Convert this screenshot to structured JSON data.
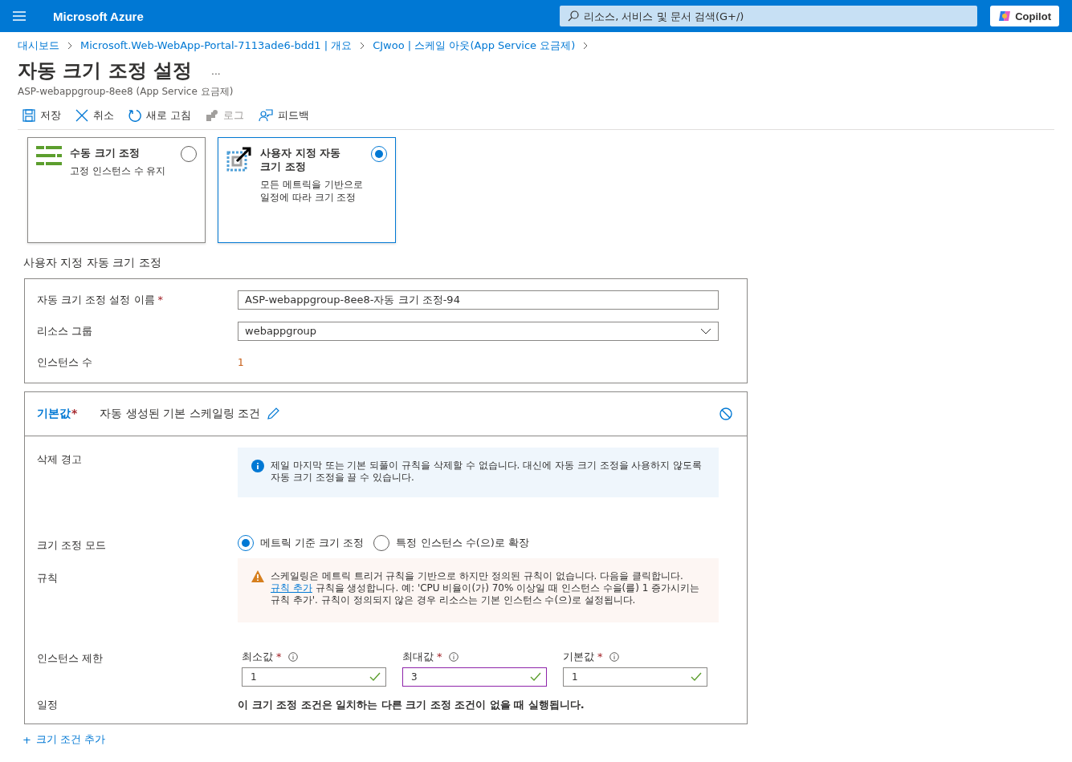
{
  "topbar": {
    "brand": "Microsoft Azure",
    "search": {
      "placeholder": "리소스, 서비스 및 문서 검색(G+/)"
    },
    "copilot": "Copilot"
  },
  "breadcrumb": [
    "대시보드",
    "Microsoft.Web-WebApp-Portal-7113ade6-bdd1 | 개요",
    "CJwoo | 스케일 아웃(App Service 요금제)"
  ],
  "header": {
    "title": "자동 크기 조정 설정",
    "more": "...",
    "subtitle": "ASP-webappgroup-8ee8 (App Service 요금제)"
  },
  "toolbar": [
    {
      "kind": "save",
      "label": "저장",
      "disabled": false
    },
    {
      "kind": "cancel",
      "label": "취소",
      "disabled": false
    },
    {
      "kind": "refresh",
      "label": "새로 고침",
      "disabled": false
    },
    {
      "kind": "logs",
      "label": "로그",
      "disabled": true
    },
    {
      "kind": "feedback",
      "label": "피드백",
      "disabled": false
    }
  ],
  "options": [
    {
      "kind": "manual",
      "title": "수동 크기 조정",
      "description": "고정 인스턴스 수 유지",
      "selected": false
    },
    {
      "kind": "custom",
      "title": "사용자 지정 자동 크기 조정",
      "description": "모든 메트릭을 기반으로 일정에 따라 크기 조정",
      "selected": true
    }
  ],
  "section_title": "사용자 지정 자동 크기 조정",
  "settings": [
    {
      "kind": "text",
      "label": "자동 크기 조정 설정 이름",
      "required_mark": "*",
      "value": "ASP-webappgroup-8ee8-자동 크기 조정-94"
    },
    {
      "kind": "dropdown",
      "label": "리소스 그룹",
      "value": "webappgroup"
    },
    {
      "kind": "static",
      "label": "인스턴스 수",
      "value": "1"
    }
  ],
  "condition": {
    "tab": "기본값",
    "required_mark": "*",
    "name": "자동 생성된 기본 스케일링 조건",
    "delete_warning": {
      "label": "삭제 경고",
      "text": "제일 마지막 또는 기본 되풀이 규칙을 삭제할 수 없습니다. 대신에 자동 크기 조정을 사용하지 않도록 자동 크기 조정을 끌 수 있습니다."
    },
    "mode": {
      "label": "크기 조정 모드",
      "options": [
        {
          "label": "메트릭 기준 크기 조정",
          "selected": true
        },
        {
          "label": "특정 인스턴스 수(으)로 확장",
          "selected": false
        }
      ]
    },
    "rules": {
      "label": "규칙",
      "text_before": "스케일링은 메트릭 트리거 규칙을 기반으로 하지만 정의된 규칙이 없습니다. 다음을 클릭합니다.",
      "link": "규칙 추가",
      "text_after": " 규칙을 생성합니다. 예: 'CPU 비율이(가) 70% 이상일 때 인스턴스 수을(를) 1 증가시키는 규칙 추가'. 규칙이 정의되지 않은 경우 리소스는 기본 인스턴스 수(으)로 설정됩니다."
    },
    "limits": {
      "label": "인스턴스 제한",
      "fields": [
        {
          "label": "최소값",
          "required_mark": "*",
          "value": "1",
          "focused": false
        },
        {
          "label": "최대값",
          "required_mark": "*",
          "value": "3",
          "focused": true
        },
        {
          "label": "기본값",
          "required_mark": "*",
          "value": "1",
          "focused": false
        }
      ]
    },
    "schedule": {
      "label": "일정",
      "text": "이 크기 조정 조건은 일치하는 다른 크기 조정 조건이 없을 때 실행됩니다."
    }
  },
  "add_condition": {
    "icon": "+",
    "label": "크기 조건 추가"
  }
}
